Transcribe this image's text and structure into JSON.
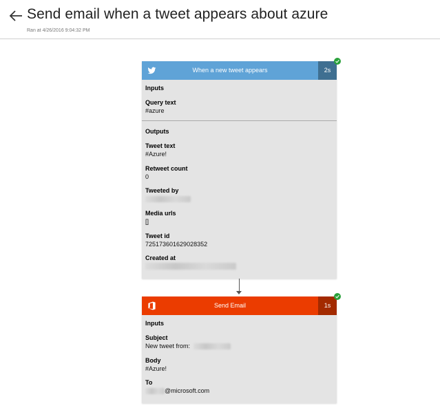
{
  "header": {
    "title": "Send email when a tweet appears about azure",
    "subtitle": "Ran at 4/26/2016 9:04:32 PM"
  },
  "twitter_card": {
    "title": "When a new tweet appears",
    "duration": "2s",
    "accent": "#5fa3d7",
    "inputs_label": "Inputs",
    "query_text_label": "Query text",
    "query_text_value": "#azure",
    "outputs_label": "Outputs",
    "tweet_text_label": "Tweet text",
    "tweet_text_value": "#Azure!",
    "retweet_count_label": "Retweet count",
    "retweet_count_value": "0",
    "tweeted_by_label": "Tweeted by",
    "media_urls_label": "Media urls",
    "media_urls_value": "[]",
    "tweet_id_label": "Tweet id",
    "tweet_id_value": "725173601629028352",
    "created_at_label": "Created at"
  },
  "email_card": {
    "title": "Send Email",
    "duration": "1s",
    "accent": "#eb3c00",
    "inputs_label": "Inputs",
    "subject_label": "Subject",
    "subject_value": "New tweet from:",
    "body_label": "Body",
    "body_value": "#Azure!",
    "to_label": "To",
    "to_value": "@microsoft.com"
  },
  "status_color": "#2aa13b"
}
